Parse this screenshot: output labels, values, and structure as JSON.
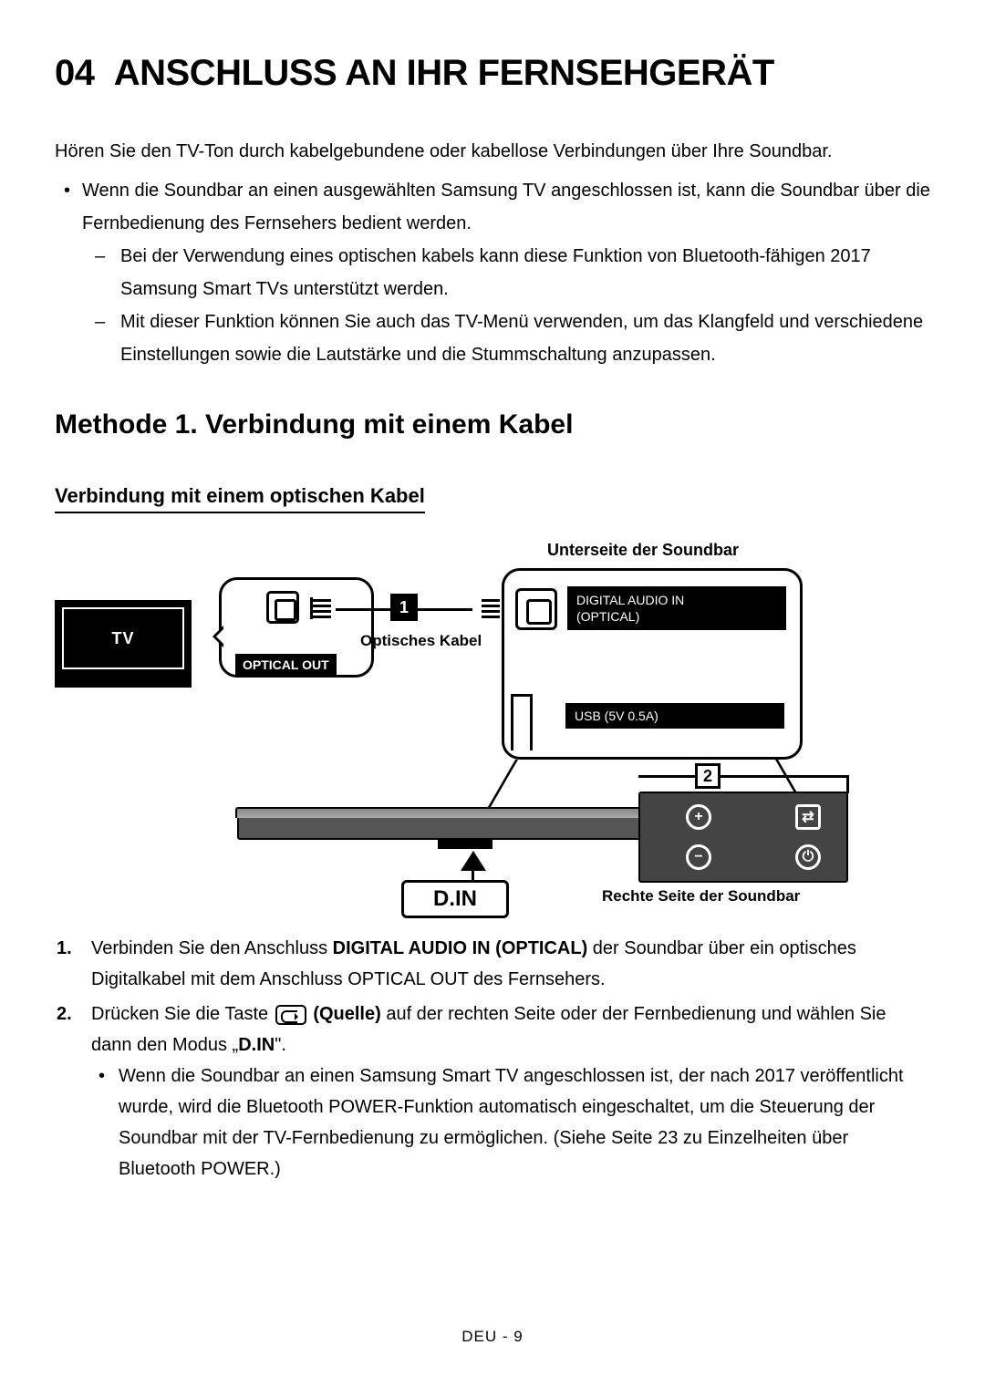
{
  "chapter": {
    "number": "04",
    "title": "ANSCHLUSS AN IHR FERNSEHGERÄT"
  },
  "intro": "Hören Sie den TV-Ton durch kabelgebundene oder kabellose Verbindungen über Ihre Soundbar.",
  "bullet1": "Wenn die Soundbar an einen ausgewählten Samsung TV angeschlossen ist, kann die Soundbar über die Fernbedienung des Fernsehers bedient werden.",
  "sub_dash1": "Bei der Verwendung eines optischen kabels kann diese Funktion von Bluetooth-fähigen 2017 Samsung Smart TVs unterstützt werden.",
  "sub_dash2": "Mit dieser Funktion können Sie auch das TV-Menü verwenden, um das Klangfeld und verschiedene Einstellungen sowie die Lautstärke und die Stummschaltung anzupassen.",
  "method_title": "Methode 1. Verbindung mit einem Kabel",
  "sub_title": "Verbindung mit einem optischen Kabel",
  "diagram": {
    "top_right_label": "Unterseite der Soundbar",
    "tv_label": "TV",
    "optical_out": "OPTICAL OUT",
    "cable_marker": "1",
    "cable_text": "Optisches Kabel",
    "dai_line1": "DIGITAL AUDIO IN",
    "dai_line2": "(OPTICAL)",
    "usb_text": "USB (5V 0.5A)",
    "callout2": "2",
    "din": "D.IN",
    "right_side_label": "Rechte Seite der Soundbar",
    "side_plus": "+",
    "side_minus": "−",
    "side_src": "⇄",
    "side_pwr": "⏻"
  },
  "step1": {
    "num": "1.",
    "pre": "Verbinden Sie den Anschluss ",
    "bold": "DIGITAL AUDIO IN (OPTICAL)",
    "post": " der Soundbar über ein optisches Digitalkabel mit dem Anschluss OPTICAL OUT des Fernsehers."
  },
  "step2": {
    "num": "2.",
    "pre": "Drücken Sie die Taste ",
    "bold": "(Quelle)",
    "mid": " auf der rechten Seite oder der Fernbedienung und wählen Sie dann den Modus „",
    "bold2": "D.IN",
    "post": "\"."
  },
  "step2_bullet": "Wenn die Soundbar an einen Samsung Smart TV angeschlossen ist, der nach 2017 veröffentlicht wurde, wird die Bluetooth POWER-Funktion automatisch eingeschaltet, um die Steuerung der Soundbar mit der TV-Fernbedienung zu ermöglichen. (Siehe Seite 23 zu Einzelheiten über Bluetooth POWER.)",
  "footer": "DEU - 9"
}
